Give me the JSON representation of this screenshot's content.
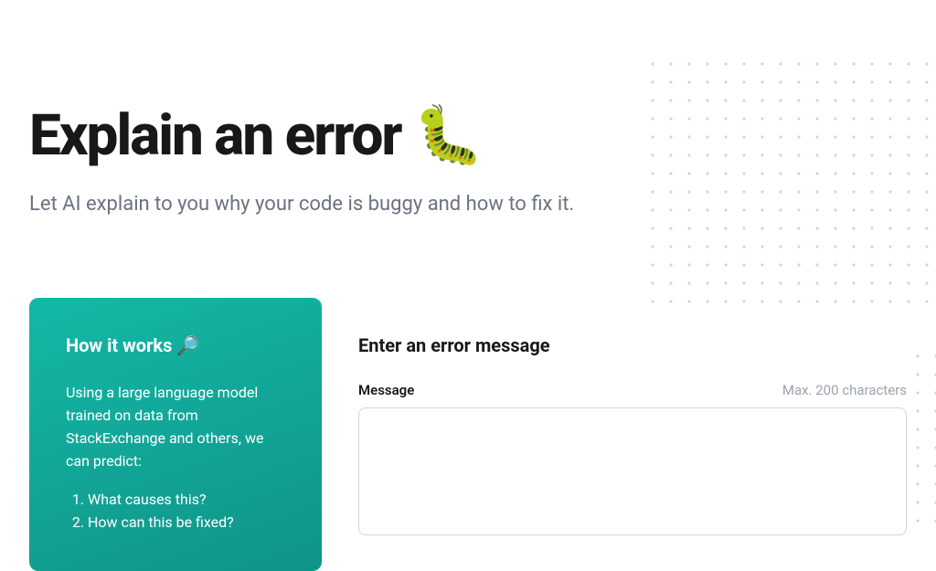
{
  "hero": {
    "title": "Explain an error 🐛",
    "subtitle": "Let AI explain to you why your code is buggy and how to fix it."
  },
  "sidebar": {
    "title": "How it works 🔎",
    "description": "Using a large language model trained on data from StackExchange and others, we can predict:",
    "items": [
      "What causes this?",
      "How can this be fixed?"
    ]
  },
  "form": {
    "title": "Enter an error message",
    "message_label": "Message",
    "message_hint": "Max. 200 characters",
    "message_value": ""
  }
}
